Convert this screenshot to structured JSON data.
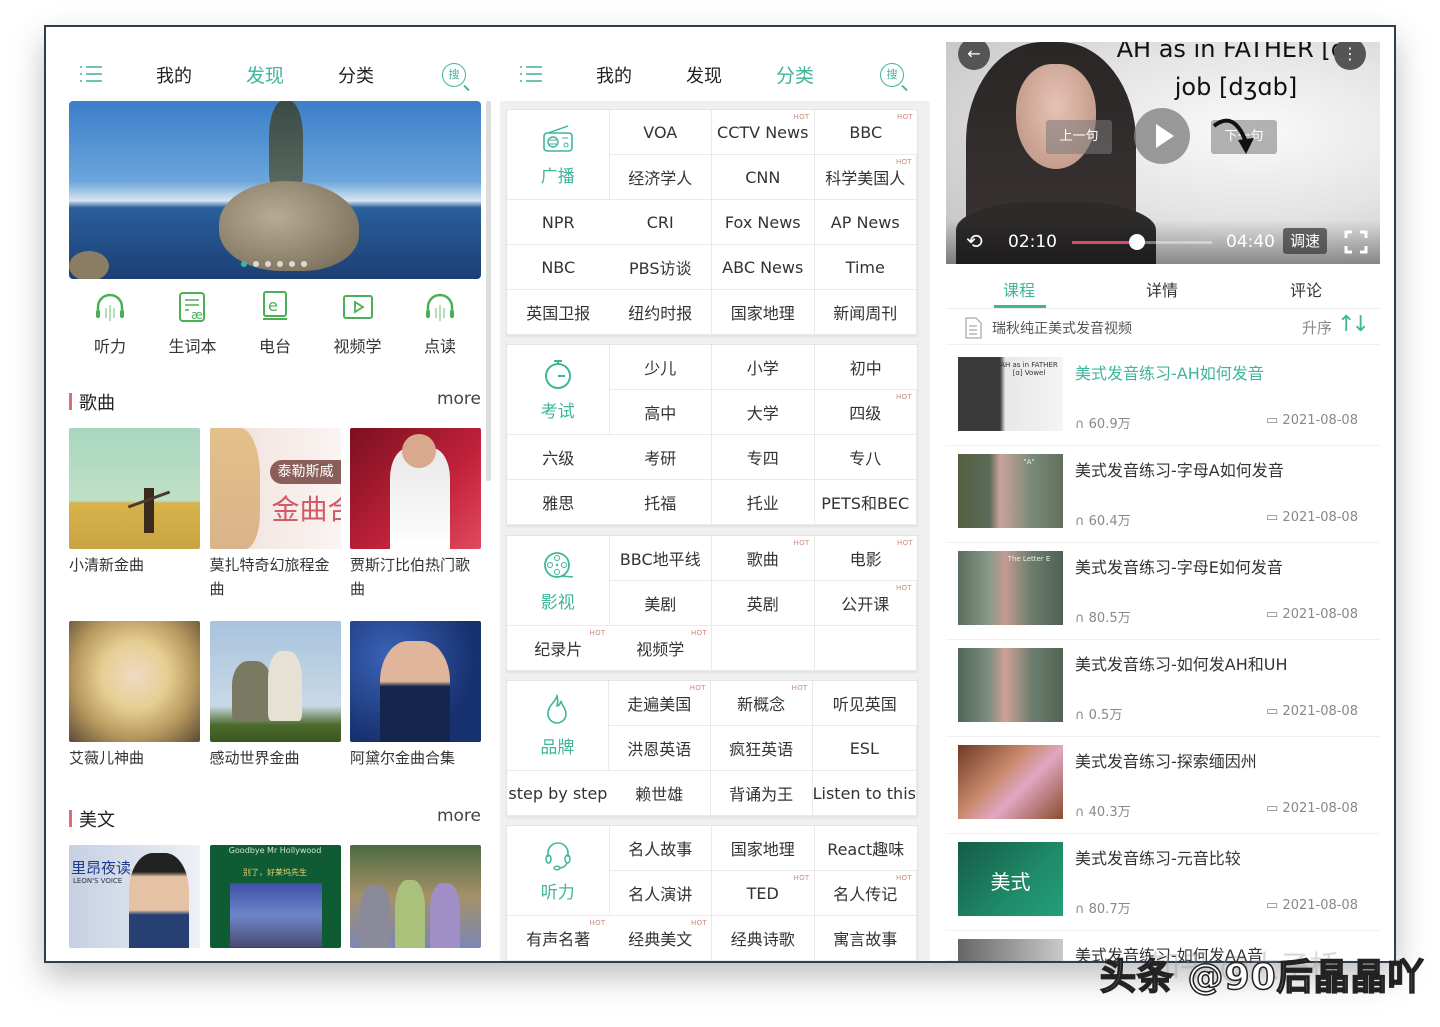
{
  "accent_color": "#3fb59a",
  "section_bar_color": "#e06b77",
  "hot_label": "HOT",
  "panel1": {
    "nav": {
      "menu_icon": "menu-list-icon",
      "tabs": [
        {
          "label": "我的",
          "active": false
        },
        {
          "label": "发现",
          "active": true
        },
        {
          "label": "分类",
          "active": false
        }
      ],
      "search_label": "搜"
    },
    "banner": {
      "dots": 6,
      "active_dot": 1
    },
    "quick_links": [
      {
        "label": "听力",
        "icon": "headphones-icon"
      },
      {
        "label": "生词本",
        "icon": "vocabulary-book-icon"
      },
      {
        "label": "电台",
        "icon": "radio-e-book-icon"
      },
      {
        "label": "视频学",
        "icon": "video-play-icon"
      },
      {
        "label": "点读",
        "icon": "headphones-icon"
      }
    ],
    "songs_section": {
      "title": "歌曲",
      "more": "more",
      "items": [
        {
          "caption": "小清新金曲"
        },
        {
          "caption": "莫扎特奇幻旅程金曲",
          "overlay_tag": "泰勒斯威",
          "overlay_text": "金曲合"
        },
        {
          "caption": "贾斯汀比伯热门歌曲"
        },
        {
          "caption": "艾薇儿神曲"
        },
        {
          "caption": "感动世界金曲"
        },
        {
          "caption": "阿黛尔金曲合集"
        }
      ]
    },
    "prose_section": {
      "title": "美文",
      "more": "more",
      "items": [
        {
          "overlay_title": "里昂夜读",
          "overlay_sub": "LEON'S VOICE"
        },
        {
          "overlay_title": "Goodbye Mr Hollywood",
          "overlay_sub": "别了，好莱坞先生"
        },
        {
          "overlay_title": ""
        }
      ]
    }
  },
  "panel2": {
    "nav": {
      "tabs": [
        {
          "label": "我的",
          "active": false
        },
        {
          "label": "发现",
          "active": false
        },
        {
          "label": "分类",
          "active": true
        }
      ],
      "search_label": "搜"
    },
    "categories": [
      {
        "name": "广播",
        "icon": "radio-icon",
        "items": [
          {
            "label": "VOA",
            "hot": false
          },
          {
            "label": "CCTV News",
            "hot": true
          },
          {
            "label": "BBC",
            "hot": true
          },
          {
            "label": "经济学人",
            "hot": false
          },
          {
            "label": "CNN",
            "hot": false
          },
          {
            "label": "科学美国人",
            "hot": true
          },
          {
            "label": "NPR",
            "hot": false
          },
          {
            "label": "CRI",
            "hot": false
          },
          {
            "label": "Fox News",
            "hot": false
          },
          {
            "label": "AP News",
            "hot": false
          },
          {
            "label": "NBC",
            "hot": false
          },
          {
            "label": "PBS访谈",
            "hot": false
          },
          {
            "label": "ABC News",
            "hot": false
          },
          {
            "label": "Time",
            "hot": false
          },
          {
            "label": "英国卫报",
            "hot": false
          },
          {
            "label": "纽约时报",
            "hot": false
          },
          {
            "label": "国家地理",
            "hot": false
          },
          {
            "label": "新闻周刊",
            "hot": false
          }
        ]
      },
      {
        "name": "考试",
        "icon": "stopwatch-icon",
        "items": [
          {
            "label": "少儿",
            "hot": false
          },
          {
            "label": "小学",
            "hot": false
          },
          {
            "label": "初中",
            "hot": false
          },
          {
            "label": "高中",
            "hot": false
          },
          {
            "label": "大学",
            "hot": false
          },
          {
            "label": "四级",
            "hot": true
          },
          {
            "label": "六级",
            "hot": false
          },
          {
            "label": "考研",
            "hot": false
          },
          {
            "label": "专四",
            "hot": false
          },
          {
            "label": "专八",
            "hot": false
          },
          {
            "label": "雅思",
            "hot": false
          },
          {
            "label": "托福",
            "hot": false
          },
          {
            "label": "托业",
            "hot": false
          },
          {
            "label": "PETS和BEC",
            "hot": false
          }
        ]
      },
      {
        "name": "影视",
        "icon": "film-reel-icon",
        "items": [
          {
            "label": "BBC地平线",
            "hot": false
          },
          {
            "label": "歌曲",
            "hot": true
          },
          {
            "label": "电影",
            "hot": true
          },
          {
            "label": "美剧",
            "hot": false
          },
          {
            "label": "英剧",
            "hot": false
          },
          {
            "label": "公开课",
            "hot": true
          },
          {
            "label": "纪录片",
            "hot": true
          },
          {
            "label": "视频学",
            "hot": true
          },
          {
            "label": "",
            "hot": false
          },
          {
            "label": "",
            "hot": false
          }
        ]
      },
      {
        "name": "品牌",
        "icon": "flame-icon",
        "items": [
          {
            "label": "走遍美国",
            "hot": true
          },
          {
            "label": "新概念",
            "hot": true
          },
          {
            "label": "听见英国",
            "hot": false
          },
          {
            "label": "洪恩英语",
            "hot": false
          },
          {
            "label": "疯狂英语",
            "hot": false
          },
          {
            "label": "ESL",
            "hot": false
          },
          {
            "label": "step by step",
            "hot": false
          },
          {
            "label": "赖世雄",
            "hot": false
          },
          {
            "label": "背诵为王",
            "hot": false
          },
          {
            "label": "Listen to this",
            "hot": false
          }
        ]
      },
      {
        "name": "听力",
        "icon": "headset-icon",
        "items": [
          {
            "label": "名人故事",
            "hot": false
          },
          {
            "label": "国家地理",
            "hot": false
          },
          {
            "label": "React趣味",
            "hot": false
          },
          {
            "label": "名人演讲",
            "hot": false
          },
          {
            "label": "TED",
            "hot": true
          },
          {
            "label": "名人传记",
            "hot": true
          },
          {
            "label": "有声名著",
            "hot": true
          },
          {
            "label": "经典美文",
            "hot": true
          },
          {
            "label": "经典诗歌",
            "hot": false
          },
          {
            "label": "寓言故事",
            "hot": false
          }
        ]
      }
    ]
  },
  "panel3": {
    "video": {
      "title_line1": "AH as in FATHER [ɑ]",
      "title_line2": "job [dʒɑb]",
      "prev_sentence": "上一句",
      "next_sentence": "下一句",
      "current_time": "02:10",
      "total_time": "04:40",
      "progress": 0.464,
      "speed_label": "调速"
    },
    "tabs": [
      {
        "label": "课程",
        "active": true
      },
      {
        "label": "详情",
        "active": false
      },
      {
        "label": "评论",
        "active": false
      }
    ],
    "course_name": "瑞秋纯正美式发音视频",
    "sort_label": "升序",
    "lessons": [
      {
        "title": "美式发音练习-AH如何发音",
        "plays": "60.9万",
        "date": "2021-08-08",
        "active": true,
        "thumb_text": "AH as in FATHER [ɑ] Vowel"
      },
      {
        "title": "美式发音练习-字母A如何发音",
        "plays": "60.4万",
        "date": "2021-08-08",
        "active": false,
        "thumb_text": "\"A\""
      },
      {
        "title": "美式发音练习-字母E如何发音",
        "plays": "80.5万",
        "date": "2021-08-08",
        "active": false,
        "thumb_text": "The Letter E"
      },
      {
        "title": "美式发音练习-如何发AH和UH",
        "plays": "0.5万",
        "date": "2021-08-08",
        "active": false,
        "thumb_text": ""
      },
      {
        "title": "美式发音练习-探索缅因州",
        "plays": "40.3万",
        "date": "2021-08-08",
        "active": false,
        "thumb_text": ""
      },
      {
        "title": "美式发音练习-元音比较",
        "plays": "80.7万",
        "date": "2021-08-08",
        "active": false,
        "thumb_text": "美式"
      },
      {
        "title": "美式发音练习-如何发AA音",
        "plays": "",
        "date": "",
        "active": false,
        "thumb_text": ""
      }
    ]
  },
  "watermark": "头条 @90后晶晶吖",
  "watermark_faint": "知乎 @大子桥"
}
